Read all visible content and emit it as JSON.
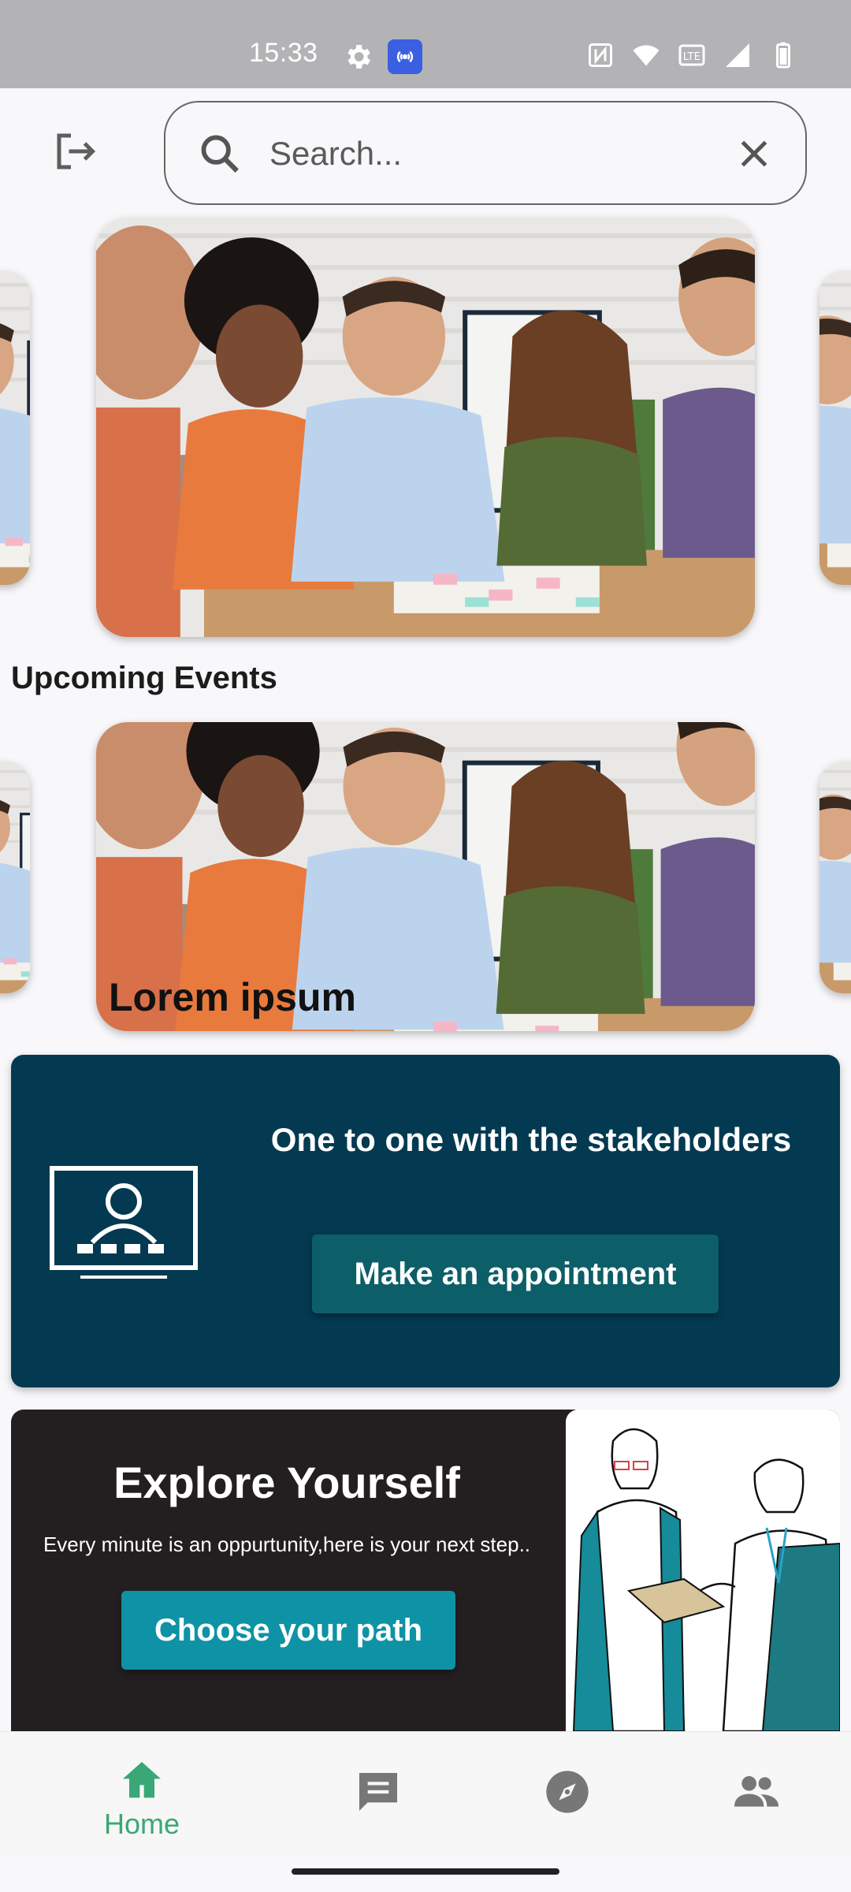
{
  "status_bar": {
    "time": "15:33",
    "icons": [
      "gear-icon",
      "hotspot-icon",
      "nfc-icon",
      "wifi-icon",
      "volte-icon",
      "signal-icon",
      "battery-icon"
    ]
  },
  "search": {
    "placeholder": "Search..."
  },
  "events": {
    "section_title": "Upcoming Events",
    "caption": "Lorem ipsum"
  },
  "stakeholder_card": {
    "title": "One to one with the stakeholders",
    "button_label": "Make an appointment",
    "icon": "presentation-screen-icon"
  },
  "explore_card": {
    "title": "Explore Yourself",
    "subtitle": "Every minute is an oppurtunity,here is your next step..",
    "button_label": "Choose your path"
  },
  "bottom_nav": {
    "items": [
      {
        "label": "Home",
        "icon": "home-icon",
        "active": true
      },
      {
        "label": "",
        "icon": "chat-icon",
        "active": false
      },
      {
        "label": "",
        "icon": "compass-icon",
        "active": false
      },
      {
        "label": "",
        "icon": "people-icon",
        "active": false
      }
    ],
    "active_color": "#3aa776",
    "inactive_color": "#777777"
  },
  "colors": {
    "stakeholder_bg": "#033a52",
    "appointment_button": "#0c5e68",
    "explore_bg": "#231f20",
    "path_button": "#0d93a5"
  }
}
